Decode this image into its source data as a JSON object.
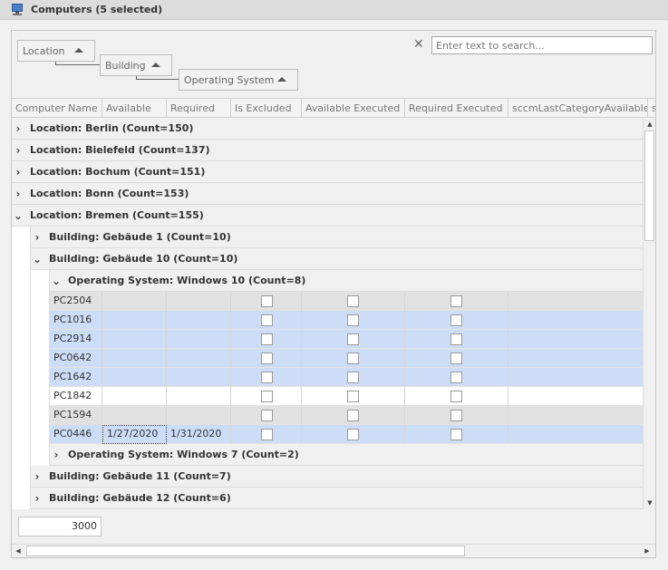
{
  "window": {
    "title": "Computers (5 selected)",
    "icon": "computer-icon"
  },
  "grouping": {
    "levels": [
      {
        "label": "Location"
      },
      {
        "label": "Building"
      },
      {
        "label": "Operating System"
      }
    ]
  },
  "search": {
    "placeholder": "Enter text to search...",
    "clear_icon": "close-icon"
  },
  "columns": [
    "Computer Name",
    "Available",
    "Required",
    "Is Excluded",
    "Available Executed",
    "Required Executed",
    "sccmLastCategoryAvailable",
    "s"
  ],
  "groups": {
    "berlin": "Location: Berlin (Count=150)",
    "bielefeld": "Location: Bielefeld (Count=137)",
    "bochum": "Location: Bochum (Count=151)",
    "bonn": "Location: Bonn (Count=153)",
    "bremen": "Location: Bremen (Count=155)",
    "geb1": "Building: Gebäude 1 (Count=10)",
    "geb10": "Building: Gebäude 10 (Count=10)",
    "win10": "Operating System: Windows 10 (Count=8)",
    "win7": "Operating System: Windows 7 (Count=2)",
    "geb11": "Building: Gebäude 11 (Count=7)",
    "geb12": "Building: Gebäude 12 (Count=6)"
  },
  "rows": [
    {
      "name": "PC2504",
      "available": "",
      "required": ""
    },
    {
      "name": "PC1016",
      "available": "",
      "required": ""
    },
    {
      "name": "PC2914",
      "available": "",
      "required": ""
    },
    {
      "name": "PC0642",
      "available": "",
      "required": ""
    },
    {
      "name": "PC1642",
      "available": "",
      "required": ""
    },
    {
      "name": "PC1842",
      "available": "",
      "required": ""
    },
    {
      "name": "PC1594",
      "available": "",
      "required": ""
    },
    {
      "name": "PC0446",
      "available": "1/27/2020",
      "required": "1/31/2020"
    }
  ],
  "footer": {
    "value": "3000"
  },
  "colors": {
    "selected_row": "#cdddf7",
    "focused_row": "#e1e1e1"
  }
}
